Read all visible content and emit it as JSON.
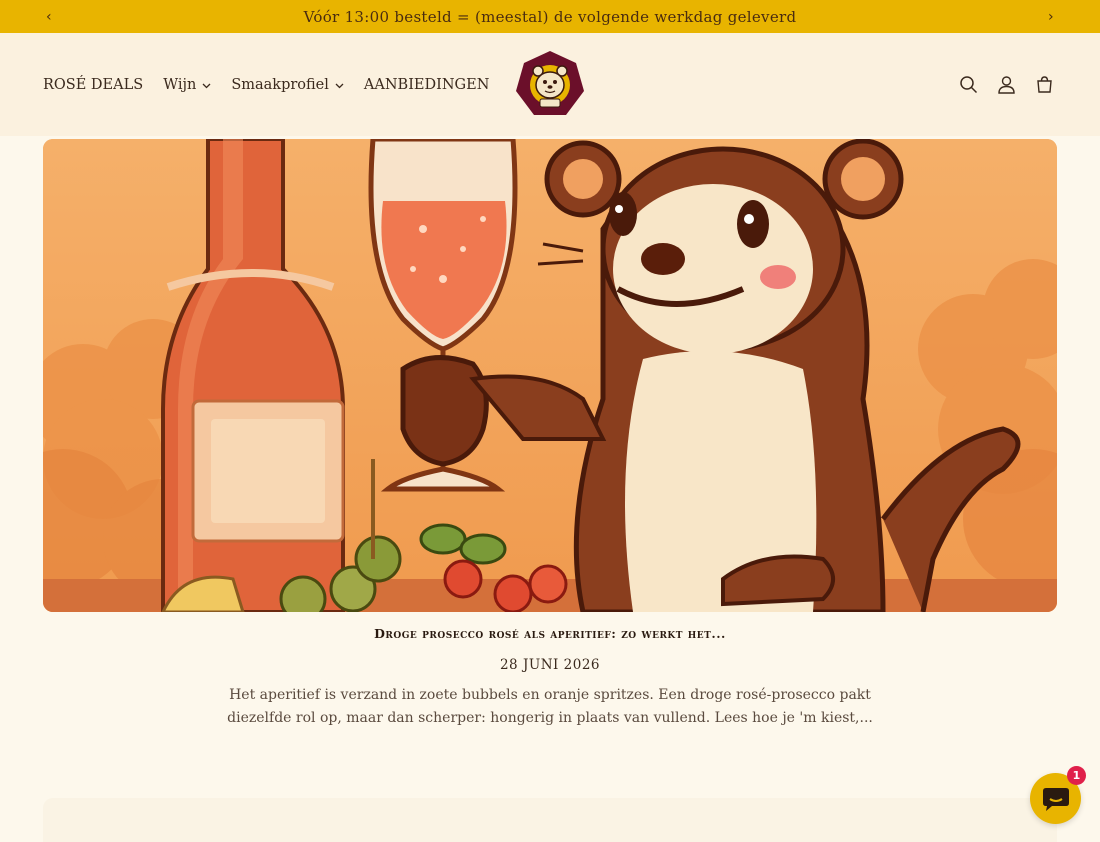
{
  "announcement": {
    "text": "Vóór 13:00 besteld = (meestal) de volgende werkdag geleverd",
    "prev_icon": "chevron-left-icon",
    "next_icon": "chevron-right-icon",
    "prev_glyph": "‹",
    "next_glyph": "›",
    "background": "#e8b400"
  },
  "nav": {
    "items": [
      {
        "label": "ROSÉ DEALS",
        "has_dropdown": false
      },
      {
        "label": "Wijn",
        "has_dropdown": true
      },
      {
        "label": "Smaakprofiel",
        "has_dropdown": true
      },
      {
        "label": "AANBIEDINGEN",
        "has_dropdown": false
      }
    ],
    "dropdown_glyph": "⌄"
  },
  "header": {
    "logo_icon": "otter-logo-icon",
    "icons": [
      "search-icon",
      "account-icon",
      "cart-icon"
    ],
    "background": "#fbf1df"
  },
  "hero": {
    "image_icon": "otter-with-rose-prosecco-illustration"
  },
  "article": {
    "title": "Droge prosecco rosé als aperitief: zo werkt het...",
    "date": "28 JUNI 2026",
    "excerpt": "Het aperitief is verzand in zoete bubbels en oranje spritzes. Een droge rosé-prosecco pakt diezelfde rol op, maar dan scherper: hongerig in plaats van vullend. Lees hoe je 'm kiest,..."
  },
  "chat": {
    "icon": "chat-bubble-icon",
    "badge_count": "1",
    "color": "#e8b400",
    "badge_color": "#e0204a"
  }
}
